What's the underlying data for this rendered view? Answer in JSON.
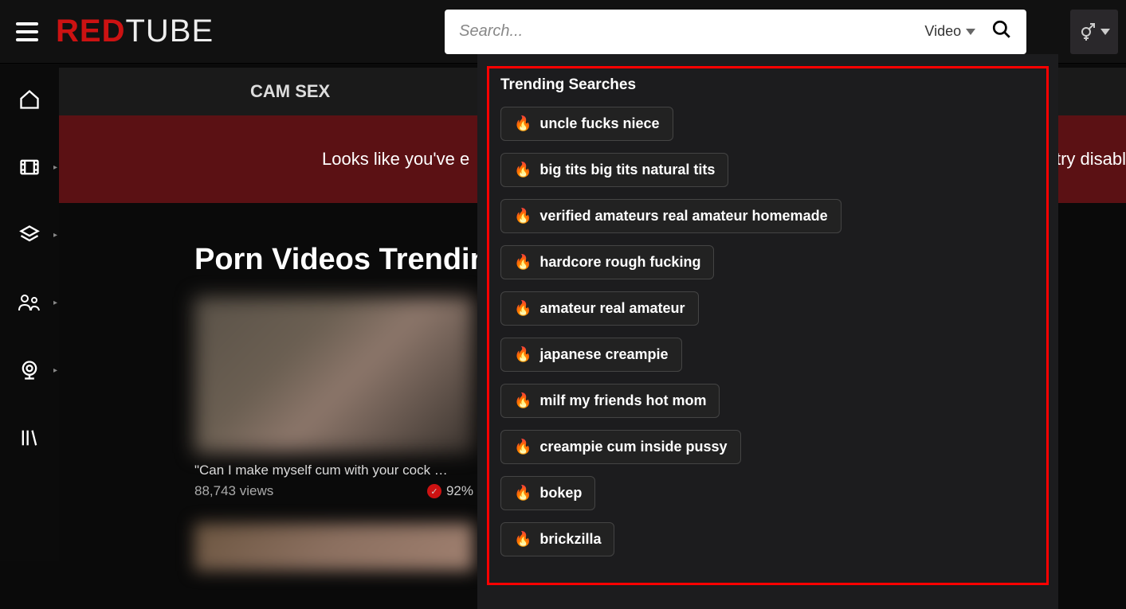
{
  "logo": {
    "part1": "RED",
    "part2": "TUBE"
  },
  "search": {
    "placeholder": "Search...",
    "type_label": "Video"
  },
  "subnav": {
    "item1": "CAM SEX"
  },
  "notice": {
    "left_text": "Looks like you've e",
    "right_text": "try disabl"
  },
  "heading": "Porn Videos Trending",
  "video1": {
    "title": "\"Can I make myself cum with your cock …",
    "views": "88,743 views",
    "rating": "92%"
  },
  "trending": {
    "title": "Trending Searches",
    "items": [
      "uncle fucks niece",
      "big tits big tits natural tits",
      "verified amateurs real amateur homemade",
      "hardcore rough fucking",
      "amateur real amateur",
      "japanese creampie",
      "milf my friends hot mom",
      "creampie cum inside pussy",
      "bokep",
      "brickzilla"
    ]
  }
}
